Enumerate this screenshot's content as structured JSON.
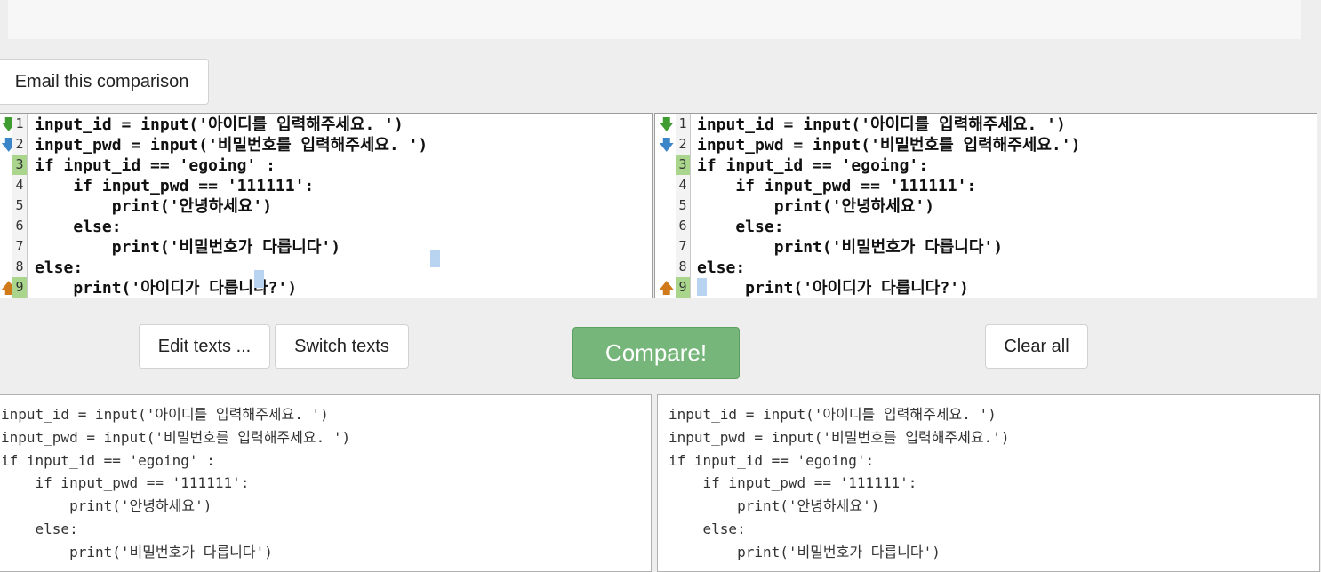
{
  "buttons": {
    "email": "Email this comparison",
    "edit": "Edit texts ...",
    "switch": "Switch texts",
    "compare": "Compare!",
    "clear": "Clear all"
  },
  "left_pane": {
    "line_numbers": [
      "1",
      "2",
      "3",
      "4",
      "5",
      "6",
      "7",
      "8",
      "9"
    ],
    "changed_lines": [
      3,
      9
    ],
    "lines": [
      "input_id = input('아이디를 입력해주세요. ')",
      "input_pwd = input('비밀번호를 입력해주세요. ')",
      "if input_id == 'egoing' :",
      "    if input_pwd == '111111':",
      "        print('안녕하세요')",
      "    else:",
      "        print('비밀번호가 다릅니다')",
      "else:",
      "    print('아이디가 다릅니다?')"
    ]
  },
  "right_pane": {
    "line_numbers": [
      "1",
      "2",
      "3",
      "4",
      "5",
      "6",
      "7",
      "8",
      "9"
    ],
    "changed_lines": [
      3,
      9
    ],
    "lines": [
      "input_id = input('아이디를 입력해주세요. ')",
      "input_pwd = input('비밀번호를 입력해주세요.')",
      "if input_id == 'egoing':",
      "    if input_pwd == '111111':",
      "        print('안녕하세요')",
      "    else:",
      "        print('비밀번호가 다릅니다')",
      "else:",
      "     print('아이디가 다릅니다?')"
    ]
  },
  "left_text": [
    "input_id = input('아이디를 입력해주세요. ')",
    "input_pwd = input('비밀번호를 입력해주세요. ')",
    "if input_id == 'egoing' :",
    "    if input_pwd == '111111':",
    "        print('안녕하세요')",
    "    else:",
    "        print('비밀번호가 다릅니다')"
  ],
  "right_text": [
    "input_id = input('아이디를 입력해주세요. ')",
    "input_pwd = input('비밀번호를 입력해주세요.')",
    "if input_id == 'egoing':",
    "    if input_pwd == '111111':",
    "        print('안녕하세요')",
    "    else:",
    "        print('비밀번호가 다릅니다')"
  ],
  "colors": {
    "compare_button": "#77b67a",
    "changed_gutter": "#a9d68c",
    "inline_highlight": "#b8d4f0"
  }
}
